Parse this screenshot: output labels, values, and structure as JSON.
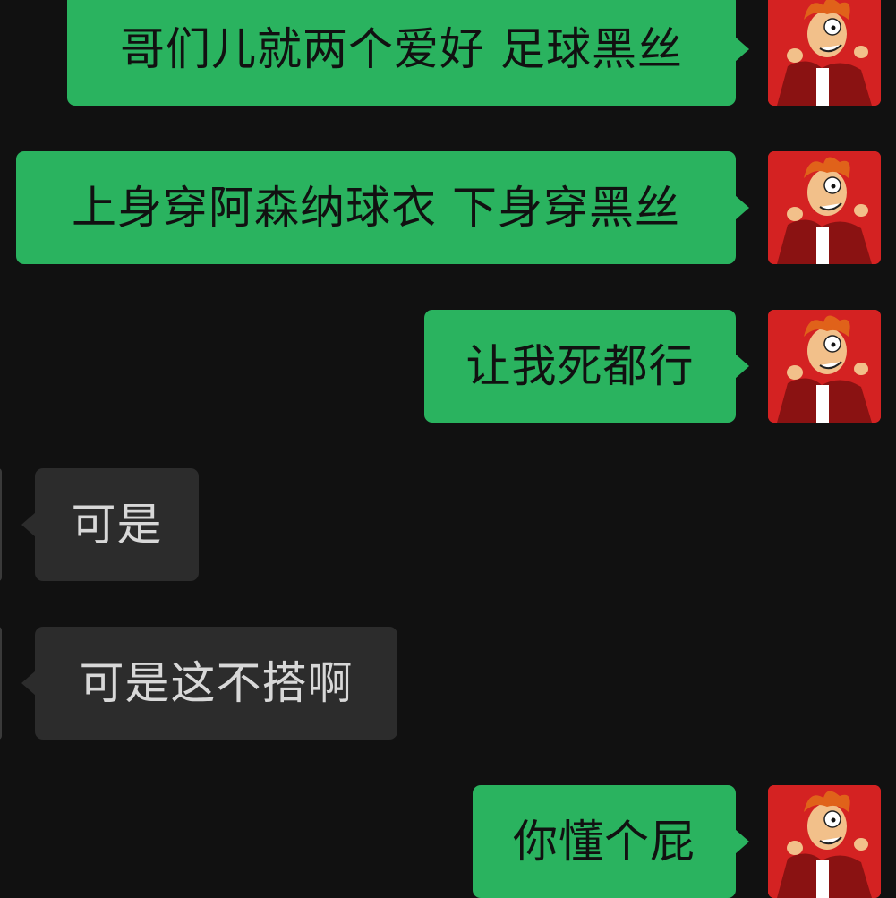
{
  "theme": {
    "background": "#111111",
    "outgoing_bubble": "#2ab35f",
    "incoming_bubble": "#2c2c2c",
    "avatar_bg": "#d42222"
  },
  "avatar": {
    "icon": "cartoon-character-avatar-icon"
  },
  "messages": [
    {
      "direction": "outgoing",
      "text": "哥们儿就两个爱好 足球黑丝"
    },
    {
      "direction": "outgoing",
      "text": "上身穿阿森纳球衣 下身穿黑丝"
    },
    {
      "direction": "outgoing",
      "text": "让我死都行"
    },
    {
      "direction": "incoming",
      "text": "可是"
    },
    {
      "direction": "incoming",
      "text": "可是这不搭啊"
    },
    {
      "direction": "outgoing",
      "text": "你懂个屁"
    }
  ]
}
